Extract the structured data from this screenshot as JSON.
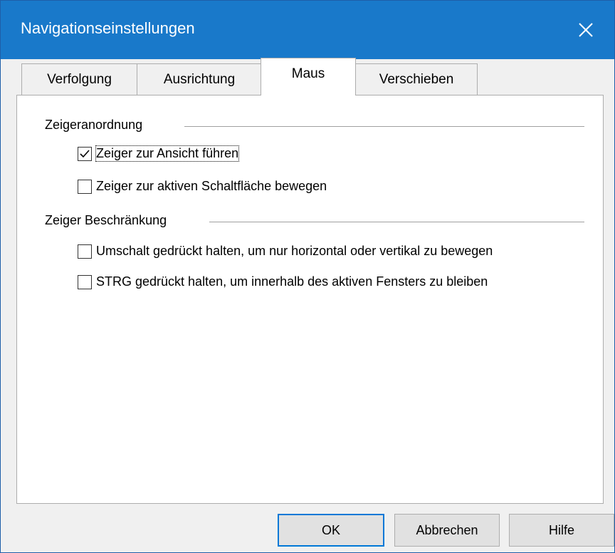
{
  "window": {
    "title": "Navigationseinstellungen",
    "close_icon": "close-icon",
    "accent_color": "#1979ca"
  },
  "tabs": [
    {
      "label": "Verfolgung",
      "active": false
    },
    {
      "label": "Ausrichtung",
      "active": false
    },
    {
      "label": "Maus",
      "active": true
    },
    {
      "label": "Verschieben",
      "active": false
    }
  ],
  "groups": {
    "pointer_placement": {
      "label": "Zeigeranordnung",
      "options": [
        {
          "label": "Zeiger zur Ansicht führen",
          "checked": true
        },
        {
          "label": "Zeiger zur aktiven Schaltfläche bewegen",
          "checked": false
        }
      ]
    },
    "pointer_restriction": {
      "label": "Zeiger Beschränkung",
      "options": [
        {
          "label": "Umschalt gedrückt halten, um nur horizontal oder vertikal zu bewegen",
          "checked": false
        },
        {
          "label": "STRG gedrückt halten, um innerhalb des aktiven Fensters zu bleiben",
          "checked": false
        }
      ]
    }
  },
  "buttons": {
    "ok": "OK",
    "cancel": "Abbrechen",
    "help": "Hilfe"
  }
}
